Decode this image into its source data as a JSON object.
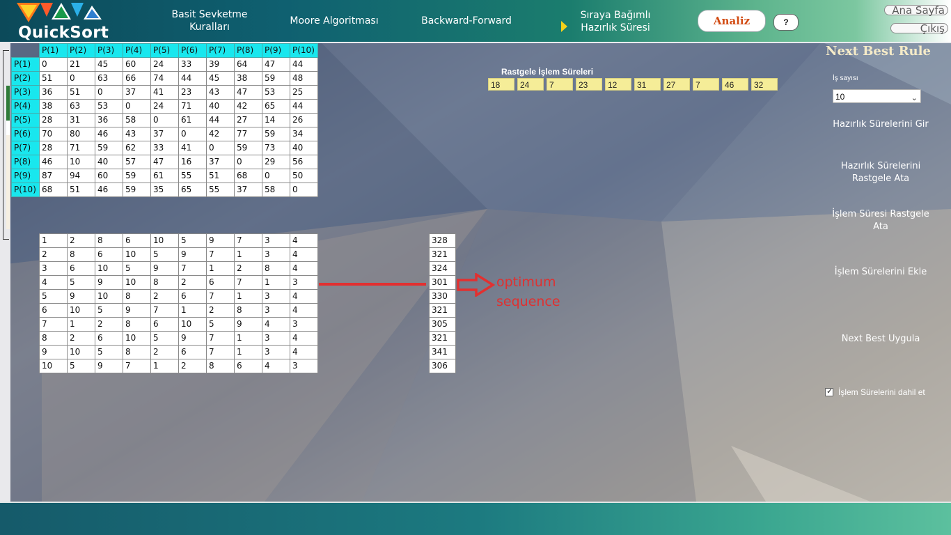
{
  "app": {
    "logo_text": "QuickSort"
  },
  "nav": {
    "item1": "Basit Sevketme Kuralları",
    "item2": "Moore Algoritması",
    "item3": "Backward-Forward",
    "item4": "Sıraya Bağımlı Hazırlık Süresi",
    "analiz": "Analiz",
    "help": "?",
    "ana_sayfa": "Ana Sayfa",
    "cikis": "Çıkış"
  },
  "matrix": {
    "col_headers": [
      "P(1)",
      "P(2)",
      "P(3)",
      "P(4)",
      "P(5)",
      "P(6)",
      "P(7)",
      "P(8)",
      "P(9)",
      "P(10)"
    ],
    "row_headers": [
      "P(1)",
      "P(2)",
      "P(3)",
      "P(4)",
      "P(5)",
      "P(6)",
      "P(7)",
      "P(8)",
      "P(9)",
      "P(10)"
    ],
    "rows": [
      [
        "0",
        "21",
        "45",
        "60",
        "24",
        "33",
        "39",
        "64",
        "47",
        "44"
      ],
      [
        "51",
        "0",
        "63",
        "66",
        "74",
        "44",
        "45",
        "38",
        "59",
        "48"
      ],
      [
        "36",
        "51",
        "0",
        "37",
        "41",
        "23",
        "43",
        "47",
        "53",
        "25"
      ],
      [
        "38",
        "63",
        "53",
        "0",
        "24",
        "71",
        "40",
        "42",
        "65",
        "44"
      ],
      [
        "28",
        "31",
        "36",
        "58",
        "0",
        "61",
        "44",
        "27",
        "14",
        "26"
      ],
      [
        "70",
        "80",
        "46",
        "43",
        "37",
        "0",
        "42",
        "77",
        "59",
        "34"
      ],
      [
        "28",
        "71",
        "59",
        "62",
        "33",
        "41",
        "0",
        "59",
        "73",
        "40"
      ],
      [
        "46",
        "10",
        "40",
        "57",
        "47",
        "16",
        "37",
        "0",
        "29",
        "56"
      ],
      [
        "87",
        "94",
        "60",
        "59",
        "61",
        "55",
        "51",
        "68",
        "0",
        "50"
      ],
      [
        "68",
        "51",
        "46",
        "59",
        "35",
        "65",
        "55",
        "37",
        "58",
        "0"
      ]
    ]
  },
  "sequences": {
    "rows": [
      [
        "1",
        "2",
        "8",
        "6",
        "10",
        "5",
        "9",
        "7",
        "3",
        "4"
      ],
      [
        "2",
        "8",
        "6",
        "10",
        "5",
        "9",
        "7",
        "1",
        "3",
        "4"
      ],
      [
        "3",
        "6",
        "10",
        "5",
        "9",
        "7",
        "1",
        "2",
        "8",
        "4"
      ],
      [
        "4",
        "5",
        "9",
        "10",
        "8",
        "2",
        "6",
        "7",
        "1",
        "3"
      ],
      [
        "5",
        "9",
        "10",
        "8",
        "2",
        "6",
        "7",
        "1",
        "3",
        "4"
      ],
      [
        "6",
        "10",
        "5",
        "9",
        "7",
        "1",
        "2",
        "8",
        "3",
        "4"
      ],
      [
        "7",
        "1",
        "2",
        "8",
        "6",
        "10",
        "5",
        "9",
        "4",
        "3"
      ],
      [
        "8",
        "2",
        "6",
        "10",
        "5",
        "9",
        "7",
        "1",
        "3",
        "4"
      ],
      [
        "9",
        "10",
        "5",
        "8",
        "2",
        "6",
        "7",
        "1",
        "3",
        "4"
      ],
      [
        "10",
        "5",
        "9",
        "7",
        "1",
        "2",
        "8",
        "6",
        "4",
        "3"
      ]
    ],
    "totals": [
      "328",
      "321",
      "324",
      "301",
      "330",
      "321",
      "305",
      "321",
      "341",
      "306"
    ]
  },
  "annotation": {
    "line1": "optimum",
    "line2": "sequence",
    "color": "#e03030"
  },
  "rastgele": {
    "label": "Rastgele İşlem Süreleri",
    "values": [
      "18",
      "24",
      "7",
      "23",
      "12",
      "31",
      "27",
      "7",
      "46",
      "32"
    ]
  },
  "side_panel": {
    "title": "Next Best Rule",
    "is_sayisi_label": "İş sayısı",
    "is_sayisi_value": "10",
    "btn_hazirlik_gir": "Hazırlık Sürelerini Gir",
    "btn_hazirlik_rastgele": "Hazırlık Sürelerini Rastgele Ata",
    "btn_islem_rastgele": "İşlem Süresi Rastgele Ata",
    "btn_islem_ekle": "İşlem Sürelerini Ekle",
    "btn_next_best": "Next Best Uygula",
    "checkbox_label": "İşlem Sürelerini dahil et",
    "checkbox_checked": true
  }
}
